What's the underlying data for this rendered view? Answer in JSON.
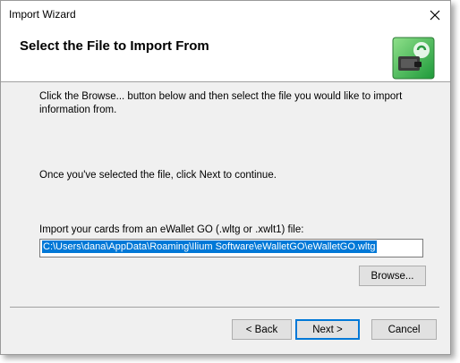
{
  "window": {
    "title": "Import Wizard",
    "close_icon": "close-icon"
  },
  "header": {
    "title": "Select the File to Import From",
    "icon": "wallet-import-icon"
  },
  "content": {
    "instruction": "Click the Browse... button below and then select the file you would like to import information from.",
    "next_hint": "Once you've selected the file, click Next to continue.",
    "file_label": "Import your cards from an eWallet GO (.wltg or .xwlt1) file:",
    "file_path": "C:\\Users\\dana\\AppData\\Roaming\\Ilium Software\\eWalletGO\\eWalletGO.wltg",
    "browse_label": "Browse..."
  },
  "footer": {
    "back_label": "< Back",
    "next_label": "Next >",
    "cancel_label": "Cancel"
  },
  "colors": {
    "selection": "#0078d7",
    "accent_green": "#3cb44a"
  }
}
